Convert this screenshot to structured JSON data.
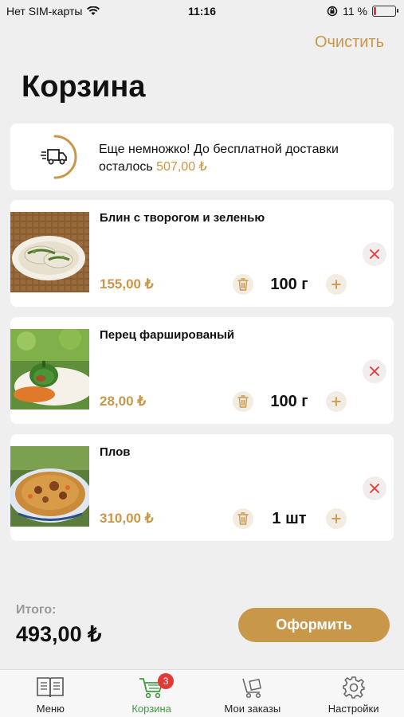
{
  "status_bar": {
    "carrier": "Нет SIM-карты",
    "time": "11:16",
    "battery": "11 %",
    "battery_level": 0.11
  },
  "header": {
    "clear_label": "Очистить",
    "title": "Корзина"
  },
  "delivery": {
    "message": "Еще немножко! До бесплатной доставки осталось",
    "amount": "507,00 ₺"
  },
  "cart": {
    "items": [
      {
        "name": "Блин с творогом и зеленью",
        "price": "155,00 ₺",
        "qty": "100 г"
      },
      {
        "name": "Перец фаршированый",
        "price": "28,00 ₺",
        "qty": "100 г"
      },
      {
        "name": "Плов",
        "price": "310,00 ₺",
        "qty": "1 шт"
      }
    ]
  },
  "footer": {
    "total_label": "Итого:",
    "total_value": "493,00 ₺",
    "checkout_label": "Оформить"
  },
  "tabs": [
    {
      "label": "Меню",
      "icon": "menu-book-icon"
    },
    {
      "label": "Корзина",
      "icon": "cart-icon",
      "badge": "3"
    },
    {
      "label": "Мои заказы",
      "icon": "orders-cart-icon"
    },
    {
      "label": "Настройки",
      "icon": "gear-icon"
    }
  ],
  "colors": {
    "accent": "#c9974a",
    "active_tab": "#3f9b43",
    "badge": "#e53935",
    "remove_icon": "#e53935"
  }
}
